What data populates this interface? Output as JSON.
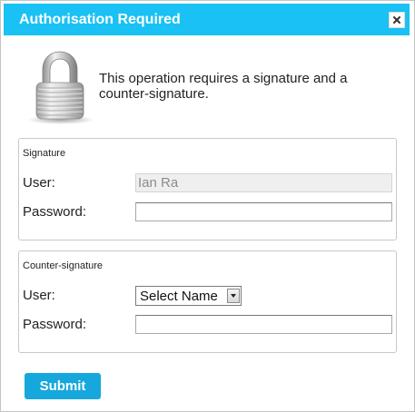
{
  "dialog": {
    "title": "Authorisation Required",
    "message": "This operation requires a signature and a counter-signature.",
    "icons": {
      "lock": "padlock-icon",
      "close": "close-icon"
    }
  },
  "signature": {
    "legend": "Signature",
    "user_label": "User:",
    "user_value": "Ian Ra",
    "password_label": "Password:",
    "password_value": ""
  },
  "counter_signature": {
    "legend": "Counter-signature",
    "user_label": "User:",
    "user_select_value": "Select Name",
    "password_label": "Password:",
    "password_value": ""
  },
  "actions": {
    "submit_label": "Submit"
  },
  "colors": {
    "titlebar": "#19c1f5",
    "submit": "#16a8dc"
  }
}
